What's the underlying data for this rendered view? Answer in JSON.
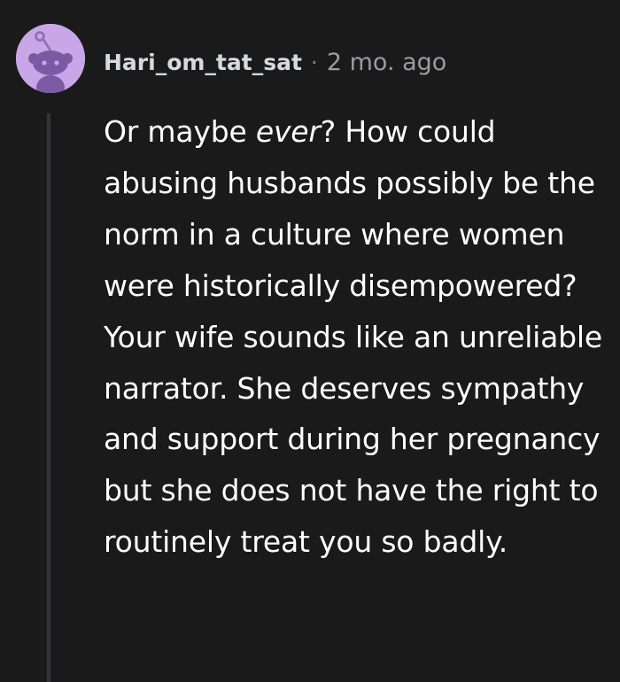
{
  "comment": {
    "author": "Hari_om_tat_sat",
    "separator": "·",
    "age": "2 mo. ago",
    "avatar_icon": "reddit-snoo-avatar-icon",
    "avatar_color": "#c9a6e8",
    "body": {
      "before_emphasis": "Or maybe ",
      "emphasis": "ever",
      "after_emphasis": "? How could abusing husbands possibly be the norm in a culture where women were historically disempowered? Your wife sounds like an unreliable narrator. She deserves sympathy and support during her pregnancy but she does not have the right to routinely treat you so badly."
    }
  },
  "colors": {
    "background": "#1a1a1b",
    "thread_line": "#343536",
    "text": "#ffffff",
    "meta_text": "#9a9c9e"
  }
}
